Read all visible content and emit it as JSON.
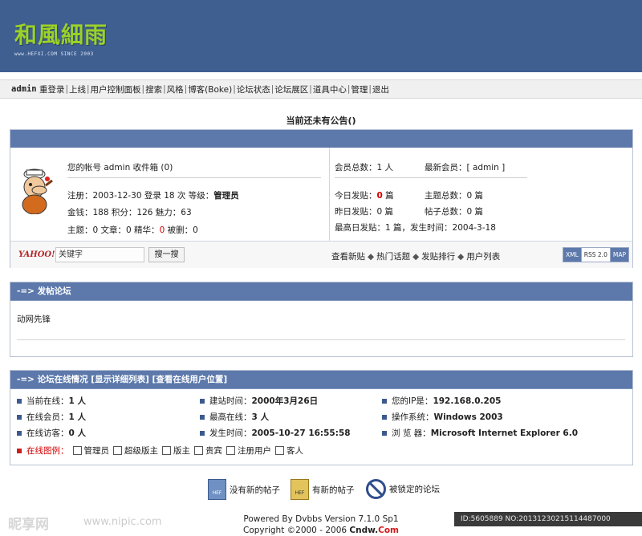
{
  "header": {
    "logo_text": "和風細雨",
    "logo_sub": "www.HEFXI.COM SINCE 2003"
  },
  "nav": {
    "user": "admin",
    "items": [
      "重登录",
      "上线",
      "用户控制面板",
      "搜索",
      "风格",
      "博客(Boke)",
      "论坛状态",
      "论坛展区",
      "道具中心",
      "管理",
      "退出"
    ],
    "separator": "|"
  },
  "announcement": "当前还未有公告()",
  "user_panel": {
    "account_line": "您的帐号 admin 收件箱 (0)",
    "register_prefix": "注册：",
    "register_date": "2003-12-30",
    "login_text": " 登录 ",
    "login_count": "18",
    "level_text": " 次  等级：",
    "level": "管理员",
    "money_label": "金钱：",
    "money": "188",
    "points_label": "  积分：",
    "points": "126",
    "charm_label": "  魅力：",
    "charm": "63",
    "topics_label": "主题：",
    "topics": "0",
    "posts_label": "  文章：",
    "posts": "0",
    "elite_label": "  精华：",
    "elite": "0",
    "deleted_label": "  被删：",
    "deleted": "0"
  },
  "stats_panel": {
    "members_label": "会员总数：",
    "members": "1 人",
    "newest_label": "最新会员：[ ",
    "newest": "admin",
    "newest_end": " ]",
    "today_label": "今日发贴：",
    "today": "0",
    "today_unit": " 篇",
    "topics_total_label": "主题总数：",
    "topics_total": "0",
    "topics_total_unit": " 篇",
    "yesterday_label": "昨日发贴：",
    "yesterday": "0",
    "yesterday_unit": " 篇",
    "posts_total_label": "帖子总数：",
    "posts_total": "0",
    "posts_total_unit": " 篇",
    "max_day_label": "最高日发贴：",
    "max_day": "1",
    "max_day_time_label": " 篇，发生时间：",
    "max_day_time": "2004-3-18"
  },
  "search": {
    "brand": "YAHOO!",
    "keyword": "关键字",
    "button": "搜一搜"
  },
  "quick_links": [
    "查看新贴",
    "热门话题",
    "发贴排行",
    "用户列表"
  ],
  "quick_link_sep": "◆",
  "feed_buttons": [
    "XML",
    "RSS 2.0",
    "MAP"
  ],
  "forums": {
    "title": "-=> 发帖论坛",
    "items": [
      "动网先锋"
    ]
  },
  "online": {
    "title": "-=> 论坛在线情况 [显示详细列表] [查看在线用户位置]",
    "stats": [
      {
        "label": "当前在线：",
        "value": "1 人"
      },
      {
        "label": "建站时间：",
        "value": "2000年3月26日"
      },
      {
        "label": "您的IP是：",
        "value": "192.168.0.205"
      },
      {
        "label": "在线会员：",
        "value": "1 人"
      },
      {
        "label": "最高在线：",
        "value": "3 人"
      },
      {
        "label": "操作系统：",
        "value": "Windows 2003"
      },
      {
        "label": "在线访客：",
        "value": "0 人"
      },
      {
        "label": "发生时间：",
        "value": "2005-10-27 16:55:58"
      },
      {
        "label": "浏 览 器：",
        "value": "Microsoft Internet Explorer 6.0"
      }
    ],
    "legend_label": "在线图例：",
    "legend": [
      "管理员",
      "超级版主",
      "版主",
      "贵宾",
      "注册用户",
      "客人"
    ]
  },
  "forum_legend": [
    "没有新的帖子",
    "有新的帖子",
    "被锁定的论坛"
  ],
  "forum_legend_icon_text": "HEF",
  "footer": {
    "powered": "Powered By Dvbbs Version 7.1.0 Sp1",
    "copyright_prefix": "Copyright ©2000 - 2006 ",
    "copyright_brand_a": "Cndw.",
    "copyright_brand_b": "Com"
  },
  "watermark": {
    "site": "昵享网",
    "url": "www.nipic.com",
    "id": "ID:5605889 NO:20131230215114487000"
  },
  "colors": {
    "header_bg": "#3f5f91",
    "bar_bg": "#5d79ab",
    "accent_red": "#d40000",
    "logo_green": "#9bd22a"
  }
}
